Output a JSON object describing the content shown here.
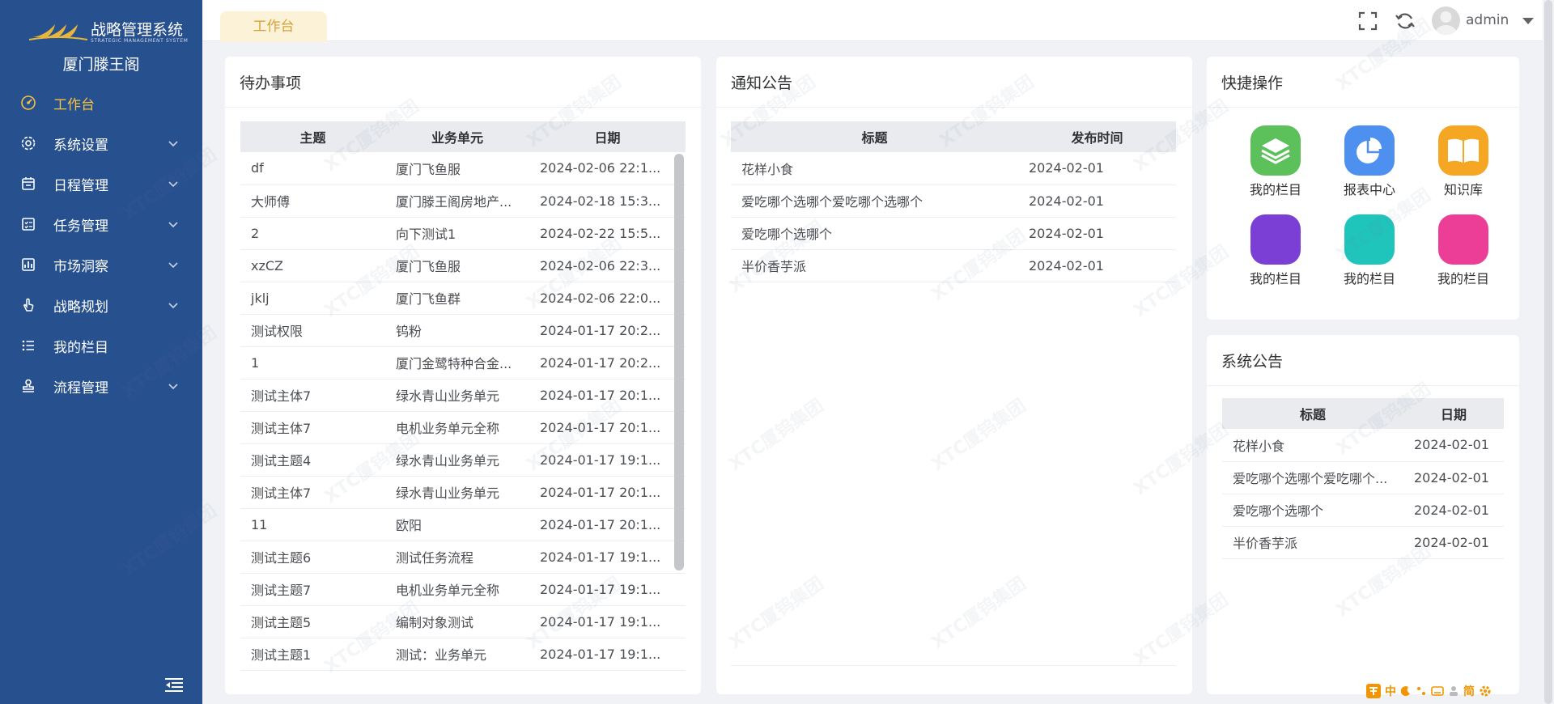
{
  "app": {
    "title": "战略管理系统",
    "subtitle": "STRATEGIC MANAGEMENT SYSTEM",
    "company": "厦门滕王阁",
    "accent": "#f5c342",
    "sidebar_bg": "#27508f"
  },
  "sidebar": {
    "items": [
      {
        "label": "工作台",
        "icon": "dashboard-icon",
        "active": true,
        "expandable": false
      },
      {
        "label": "系统设置",
        "icon": "gear-icon",
        "active": false,
        "expandable": true
      },
      {
        "label": "日程管理",
        "icon": "calendar-icon",
        "active": false,
        "expandable": true
      },
      {
        "label": "任务管理",
        "icon": "checklist-icon",
        "active": false,
        "expandable": true
      },
      {
        "label": "市场洞察",
        "icon": "chart-icon",
        "active": false,
        "expandable": true
      },
      {
        "label": "战略规划",
        "icon": "hand-pointer-icon",
        "active": false,
        "expandable": true
      },
      {
        "label": "我的栏目",
        "icon": "list-icon",
        "active": false,
        "expandable": false
      },
      {
        "label": "流程管理",
        "icon": "stamp-icon",
        "active": false,
        "expandable": true
      }
    ]
  },
  "header": {
    "tab": "工作台",
    "username": "admin"
  },
  "todo": {
    "title": "待办事项",
    "columns": [
      "主题",
      "业务单元",
      "日期"
    ],
    "rows": [
      [
        "df",
        "厦门飞鱼服",
        "2024-02-06 22:1..."
      ],
      [
        "大师傅",
        "厦门滕王阁房地产...",
        "2024-02-18 15:3..."
      ],
      [
        "2",
        "向下测试1",
        "2024-02-22 15:5..."
      ],
      [
        "xzCZ",
        "厦门飞鱼服",
        "2024-02-06 22:3..."
      ],
      [
        "jklj",
        "厦门飞鱼群",
        "2024-02-06 22:0..."
      ],
      [
        "测试权限",
        "钨粉",
        "2024-01-17 20:2..."
      ],
      [
        "1",
        "厦门金鹭特种合金...",
        "2024-01-17 20:2..."
      ],
      [
        "测试主体7",
        "绿水青山业务单元",
        "2024-01-17 20:1..."
      ],
      [
        "测试主体7",
        "电机业务单元全称",
        "2024-01-17 20:1..."
      ],
      [
        "测试主题4",
        "绿水青山业务单元",
        "2024-01-17 19:1..."
      ],
      [
        "测试主体7",
        "绿水青山业务单元",
        "2024-01-17 20:1..."
      ],
      [
        "11",
        "欧阳",
        "2024-01-17 20:1..."
      ],
      [
        "测试主题6",
        "测试任务流程",
        "2024-01-17 19:1..."
      ],
      [
        "测试主题7",
        "电机业务单元全称",
        "2024-01-17 19:1..."
      ],
      [
        "测试主题5",
        "编制对象测试",
        "2024-01-17 19:1..."
      ],
      [
        "测试主题1",
        "测试：业务单元",
        "2024-01-17 19:1..."
      ]
    ]
  },
  "notice": {
    "title": "通知公告",
    "columns": [
      "标题",
      "发布时间"
    ],
    "rows": [
      [
        "花样小食",
        "2024-02-01"
      ],
      [
        "爱吃哪个选哪个爱吃哪个选哪个",
        "2024-02-01"
      ],
      [
        "爱吃哪个选哪个",
        "2024-02-01"
      ],
      [
        "半价香芋派",
        "2024-02-01"
      ]
    ]
  },
  "quick": {
    "title": "快捷操作",
    "items": [
      {
        "label": "我的栏目",
        "color": "#5cc15a",
        "icon": "layers-icon"
      },
      {
        "label": "报表中心",
        "color": "#4e90f0",
        "icon": "pie-chart-icon"
      },
      {
        "label": "知识库",
        "color": "#f5a623",
        "icon": "book-icon"
      },
      {
        "label": "我的栏目",
        "color": "#7b3fd6",
        "icon": "tile-icon"
      },
      {
        "label": "我的栏目",
        "color": "#1fc4bb",
        "icon": "tile-icon"
      },
      {
        "label": "我的栏目",
        "color": "#ec3d97",
        "icon": "tile-icon"
      }
    ]
  },
  "sysnotice": {
    "title": "系统公告",
    "columns": [
      "标题",
      "日期"
    ],
    "rows": [
      [
        "花样小食",
        "2024-02-01"
      ],
      [
        "爱吃哪个选哪个爱吃哪个...",
        "2024-02-01"
      ],
      [
        "爱吃哪个选哪个",
        "2024-02-01"
      ],
      [
        "半价香芋派",
        "2024-02-01"
      ]
    ]
  },
  "watermark": "XTC厦钨集团",
  "ime": {
    "labels": [
      "中",
      "简"
    ]
  }
}
